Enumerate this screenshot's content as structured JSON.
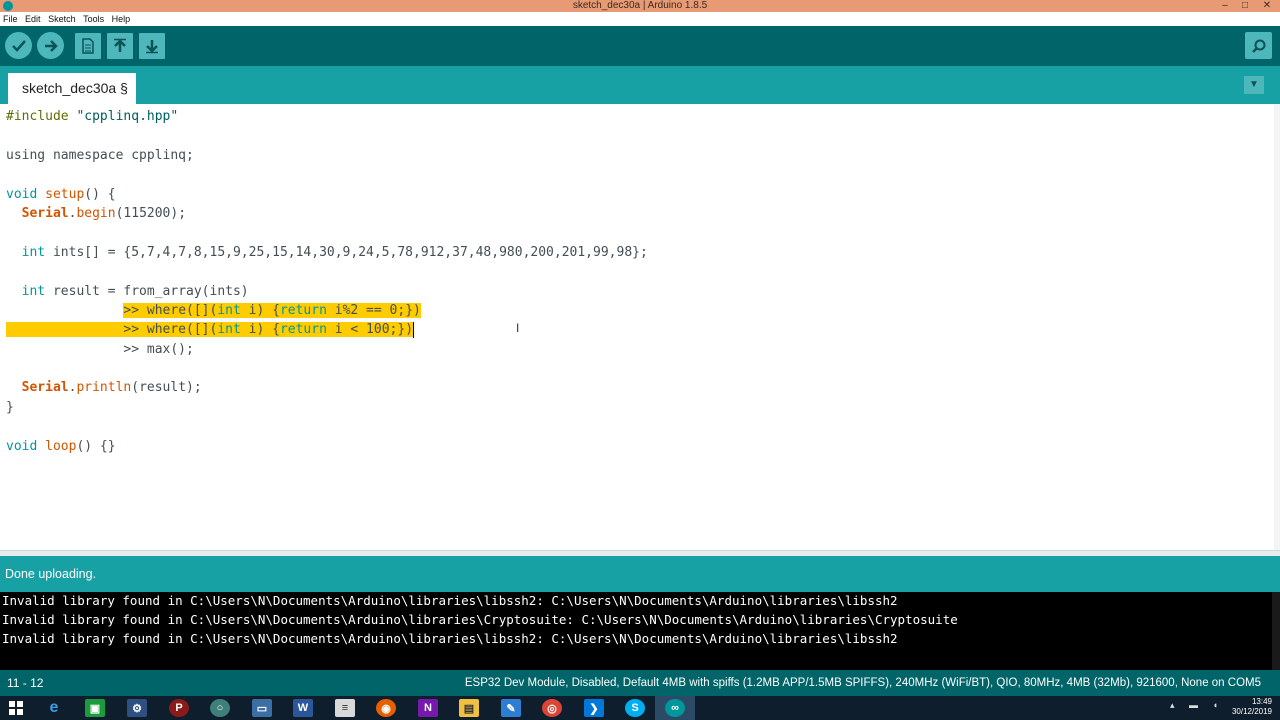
{
  "window": {
    "title": "sketch_dec30a | Arduino 1.8.5",
    "minimize": "–",
    "maximize": "□",
    "close": "✕"
  },
  "menu": [
    "File",
    "Edit",
    "Sketch",
    "Tools",
    "Help"
  ],
  "toolbar": {
    "verify_icon": "check-icon",
    "upload_icon": "arrow-right-icon",
    "new_icon": "new-file-icon",
    "open_icon": "arrow-up-icon",
    "save_icon": "arrow-down-icon",
    "serial_monitor_icon": "magnifier-icon"
  },
  "tabs": {
    "active_label": "sketch_dec30a §",
    "menu_icon": "triangle-down-icon"
  },
  "editor": {
    "lines": [
      "#include \"cpplinq.hpp\"",
      "",
      "using namespace cpplinq;",
      "",
      "void setup() {",
      "  Serial.begin(115200);",
      "",
      "  int ints[] = {5,7,4,7,8,15,9,25,15,14,30,9,24,5,78,912,37,48,980,200,201,99,98};",
      "",
      "  int result = from_array(ints)",
      "               >> where([](int i) {return i%2 == 0;})",
      "               >> where([](int i) {return i < 100;})",
      "               >> max();",
      "",
      "  Serial.println(result);",
      "}",
      "",
      "void loop() {}"
    ],
    "selection_lines": [
      11,
      12
    ]
  },
  "status": {
    "message": "Done uploading."
  },
  "console": {
    "lines": [
      "Invalid library found in C:\\Users\\N\\Documents\\Arduino\\libraries\\libssh2: C:\\Users\\N\\Documents\\Arduino\\libraries\\libssh2",
      "Invalid library found in C:\\Users\\N\\Documents\\Arduino\\libraries\\Cryptosuite: C:\\Users\\N\\Documents\\Arduino\\libraries\\Cryptosuite",
      "Invalid library found in C:\\Users\\N\\Documents\\Arduino\\libraries\\libssh2: C:\\Users\\N\\Documents\\Arduino\\libraries\\libssh2"
    ]
  },
  "boardbar": {
    "line_position": "11 - 12",
    "board": "ESP32 Dev Module, Disabled, Default 4MB with spiffs (1.2MB APP/1.5MB SPIFFS), 240MHz (WiFi/BT), QIO, 80MHz, 4MB (32Mb), 921600, None on COM5"
  },
  "taskbar": {
    "time": "13:49",
    "date": "30/12/2019",
    "apps": [
      "start",
      "edge",
      "store",
      "settings",
      "pdf",
      "chrome-alt",
      "photos",
      "word",
      "notepad",
      "firefox",
      "onenote",
      "explorer",
      "vs-tools",
      "chrome",
      "vscode",
      "skype",
      "arduino"
    ]
  }
}
